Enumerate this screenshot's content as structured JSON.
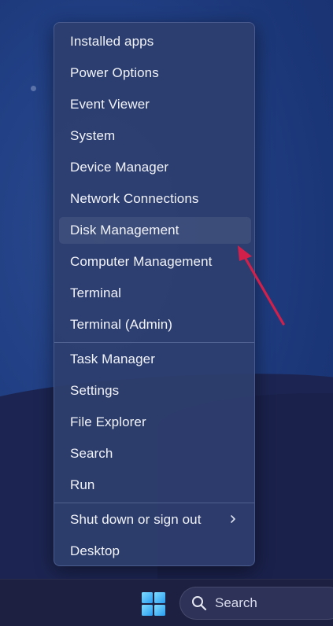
{
  "menu": {
    "group1": [
      {
        "label": "Installed apps",
        "name": "menu-item-installed-apps"
      },
      {
        "label": "Power Options",
        "name": "menu-item-power-options"
      },
      {
        "label": "Event Viewer",
        "name": "menu-item-event-viewer"
      },
      {
        "label": "System",
        "name": "menu-item-system"
      },
      {
        "label": "Device Manager",
        "name": "menu-item-device-manager"
      },
      {
        "label": "Network Connections",
        "name": "menu-item-network-connections"
      },
      {
        "label": "Disk Management",
        "name": "menu-item-disk-management"
      },
      {
        "label": "Computer Management",
        "name": "menu-item-computer-management"
      },
      {
        "label": "Terminal",
        "name": "menu-item-terminal"
      },
      {
        "label": "Terminal (Admin)",
        "name": "menu-item-terminal-admin"
      }
    ],
    "group2": [
      {
        "label": "Task Manager",
        "name": "menu-item-task-manager"
      },
      {
        "label": "Settings",
        "name": "menu-item-settings"
      },
      {
        "label": "File Explorer",
        "name": "menu-item-file-explorer"
      },
      {
        "label": "Search",
        "name": "menu-item-search"
      },
      {
        "label": "Run",
        "name": "menu-item-run"
      }
    ],
    "group3": [
      {
        "label": "Shut down or sign out",
        "name": "menu-item-shut-down",
        "has_submenu": true
      },
      {
        "label": "Desktop",
        "name": "menu-item-desktop"
      }
    ],
    "highlighted": "Disk Management"
  },
  "taskbar": {
    "start_icon": "windows-logo-icon",
    "search_icon": "search-icon",
    "search_label": "Search"
  },
  "annotation": {
    "arrow_color": "#d3204a",
    "arrow_target": "Disk Management"
  },
  "colors": {
    "menu_bg": "#2e3e6e",
    "text": "#f2f4fa",
    "windows_blue": "#4cc2ff"
  }
}
